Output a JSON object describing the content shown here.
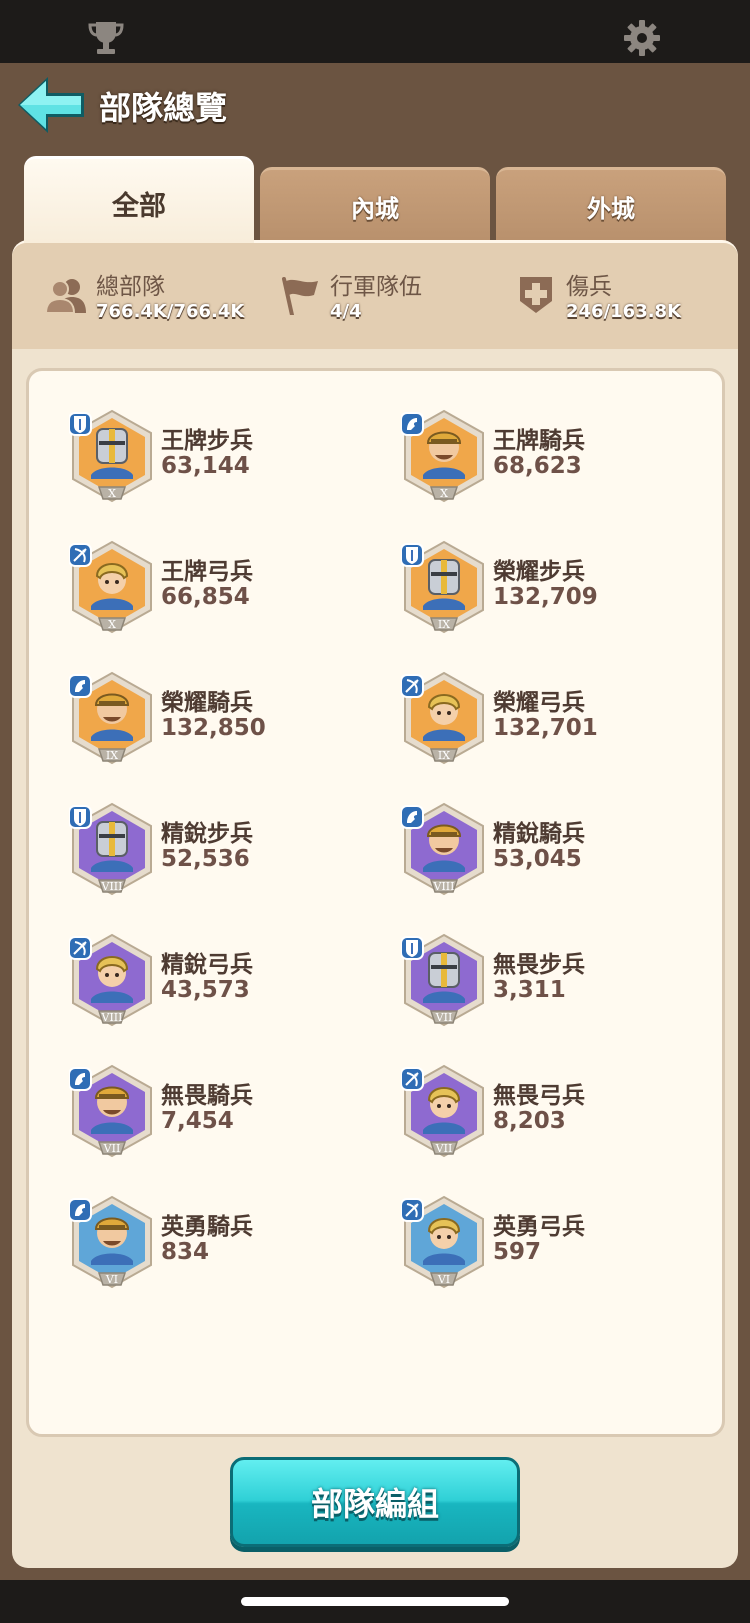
{
  "top_bar": {
    "icons": [
      "trophy-icon",
      "gear-icon"
    ]
  },
  "header": {
    "title": "部隊總覽",
    "back_icon": "back-arrow-icon"
  },
  "tabs": [
    {
      "label": "全部",
      "active": true
    },
    {
      "label": "內城",
      "active": false
    },
    {
      "label": "外城",
      "active": false
    }
  ],
  "stats": {
    "total": {
      "label": "總部隊",
      "value": "766.4K/766.4K",
      "icon": "troops-icon"
    },
    "march": {
      "label": "行軍隊伍",
      "value": "4/4",
      "icon": "flag-icon"
    },
    "wounded": {
      "label": "傷兵",
      "value": "246/163.8K",
      "icon": "medical-cross-icon"
    }
  },
  "troops": [
    {
      "name": "王牌步兵",
      "count": "63,144",
      "tier": "X",
      "type": "infantry",
      "bg": "#f0a74a"
    },
    {
      "name": "王牌騎兵",
      "count": "68,623",
      "tier": "X",
      "type": "cavalry",
      "bg": "#f0a74a"
    },
    {
      "name": "王牌弓兵",
      "count": "66,854",
      "tier": "X",
      "type": "archer",
      "bg": "#f0a74a"
    },
    {
      "name": "榮耀步兵",
      "count": "132,709",
      "tier": "IX",
      "type": "infantry",
      "bg": "#f0a74a"
    },
    {
      "name": "榮耀騎兵",
      "count": "132,850",
      "tier": "IX",
      "type": "cavalry",
      "bg": "#f0a74a"
    },
    {
      "name": "榮耀弓兵",
      "count": "132,701",
      "tier": "IX",
      "type": "archer",
      "bg": "#f0a74a"
    },
    {
      "name": "精銳步兵",
      "count": "52,536",
      "tier": "VIII",
      "type": "infantry",
      "bg": "#8e6ad0"
    },
    {
      "name": "精銳騎兵",
      "count": "53,045",
      "tier": "VIII",
      "type": "cavalry",
      "bg": "#8e6ad0"
    },
    {
      "name": "精銳弓兵",
      "count": "43,573",
      "tier": "VIII",
      "type": "archer",
      "bg": "#8e6ad0"
    },
    {
      "name": "無畏步兵",
      "count": "3,311",
      "tier": "VII",
      "type": "infantry",
      "bg": "#8e6ad0"
    },
    {
      "name": "無畏騎兵",
      "count": "7,454",
      "tier": "VII",
      "type": "cavalry",
      "bg": "#8e6ad0"
    },
    {
      "name": "無畏弓兵",
      "count": "8,203",
      "tier": "VII",
      "type": "archer",
      "bg": "#8e6ad0"
    },
    {
      "name": "英勇騎兵",
      "count": "834",
      "tier": "VI",
      "type": "cavalry",
      "bg": "#5fa6d8"
    },
    {
      "name": "英勇弓兵",
      "count": "597",
      "tier": "VI",
      "type": "archer",
      "bg": "#5fa6d8"
    }
  ],
  "buttons": {
    "formation_label": "部隊編組"
  }
}
